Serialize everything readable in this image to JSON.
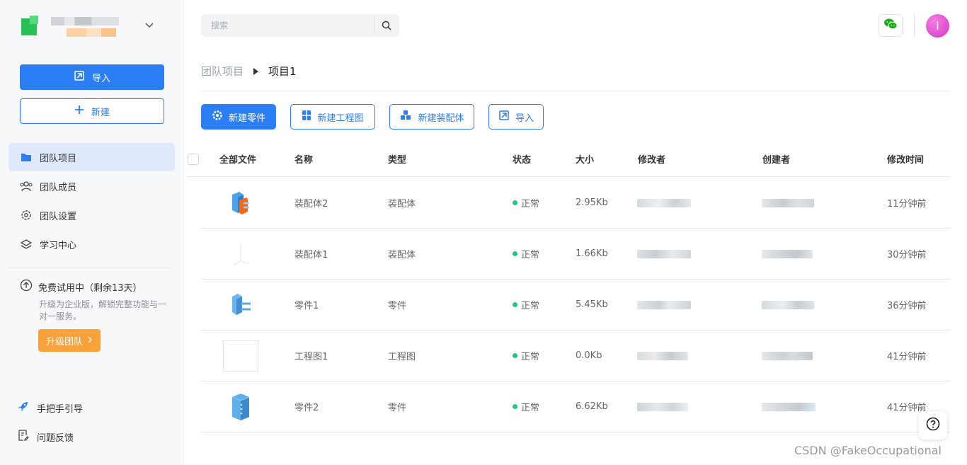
{
  "sidebar": {
    "import_label": "导入",
    "new_label": "新建",
    "nav": [
      {
        "label": "团队项目",
        "icon": "folder-icon",
        "active": true
      },
      {
        "label": "团队成员",
        "icon": "team-members-icon"
      },
      {
        "label": "团队设置",
        "icon": "gear-icon"
      },
      {
        "label": "学习中心",
        "icon": "layers-icon"
      }
    ],
    "trial": {
      "title": "免费试用中（剩余13天）",
      "desc": "升级为企业版，解锁完整功能与一对一服务。",
      "upgrade_label": "升级团队"
    },
    "footer": [
      {
        "label": "手把手引导",
        "icon": "rocket-icon"
      },
      {
        "label": "问题反馈",
        "icon": "feedback-icon"
      }
    ]
  },
  "header": {
    "search_placeholder": "搜索",
    "avatar_letter": "i"
  },
  "breadcrumb": {
    "parent": "团队项目",
    "current": "项目1"
  },
  "toolbar": {
    "new_part": "新建零件",
    "new_drawing": "新建工程图",
    "new_assembly": "新建装配体",
    "import": "导入"
  },
  "table": {
    "columns": [
      "全部文件",
      "名称",
      "类型",
      "状态",
      "大小",
      "修改者",
      "创建者",
      "修改时间"
    ],
    "rows": [
      {
        "name": "装配体2",
        "type": "装配体",
        "status": "正常",
        "size": "2.95Kb",
        "time": "11分钟前",
        "thumb": "assembly-orange"
      },
      {
        "name": "装配体1",
        "type": "装配体",
        "status": "正常",
        "size": "1.66Kb",
        "time": "30分钟前",
        "thumb": "empty-axes"
      },
      {
        "name": "零件1",
        "type": "零件",
        "status": "正常",
        "size": "5.45Kb",
        "time": "36分钟前",
        "thumb": "part-blue"
      },
      {
        "name": "工程图1",
        "type": "工程图",
        "status": "正常",
        "size": "0.0Kb",
        "time": "41分钟前",
        "thumb": "drawing-blank"
      },
      {
        "name": "零件2",
        "type": "零件",
        "status": "正常",
        "size": "6.62Kb",
        "time": "41分钟前",
        "thumb": "part-box"
      }
    ]
  },
  "watermark": "CSDN @FakeOccupational",
  "colors": {
    "primary": "#2b7ef3",
    "upgrade": "#f9a23a",
    "status_ok": "#1cc58a"
  }
}
